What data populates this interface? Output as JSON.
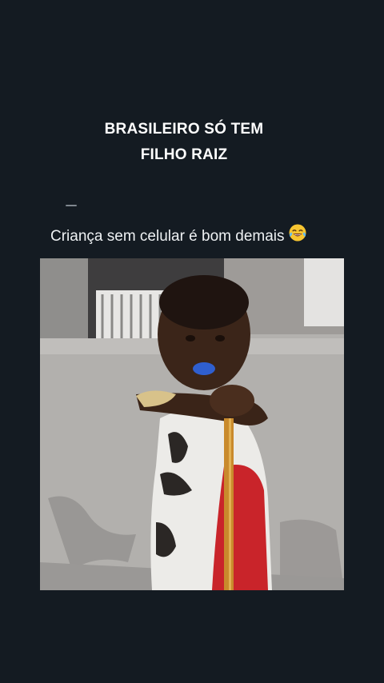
{
  "headline": {
    "line1": "BRASILEIRO SÓ TEM",
    "line2": "FILHO RAIZ"
  },
  "post": {
    "caption": "Criança sem celular é bom demais",
    "emoji_icon": "face-with-tears-of-joy-icon"
  },
  "video": {
    "scene": "child-holding-stick-video-frame"
  },
  "colors": {
    "background": "#141b22",
    "text": "#ffffff"
  }
}
